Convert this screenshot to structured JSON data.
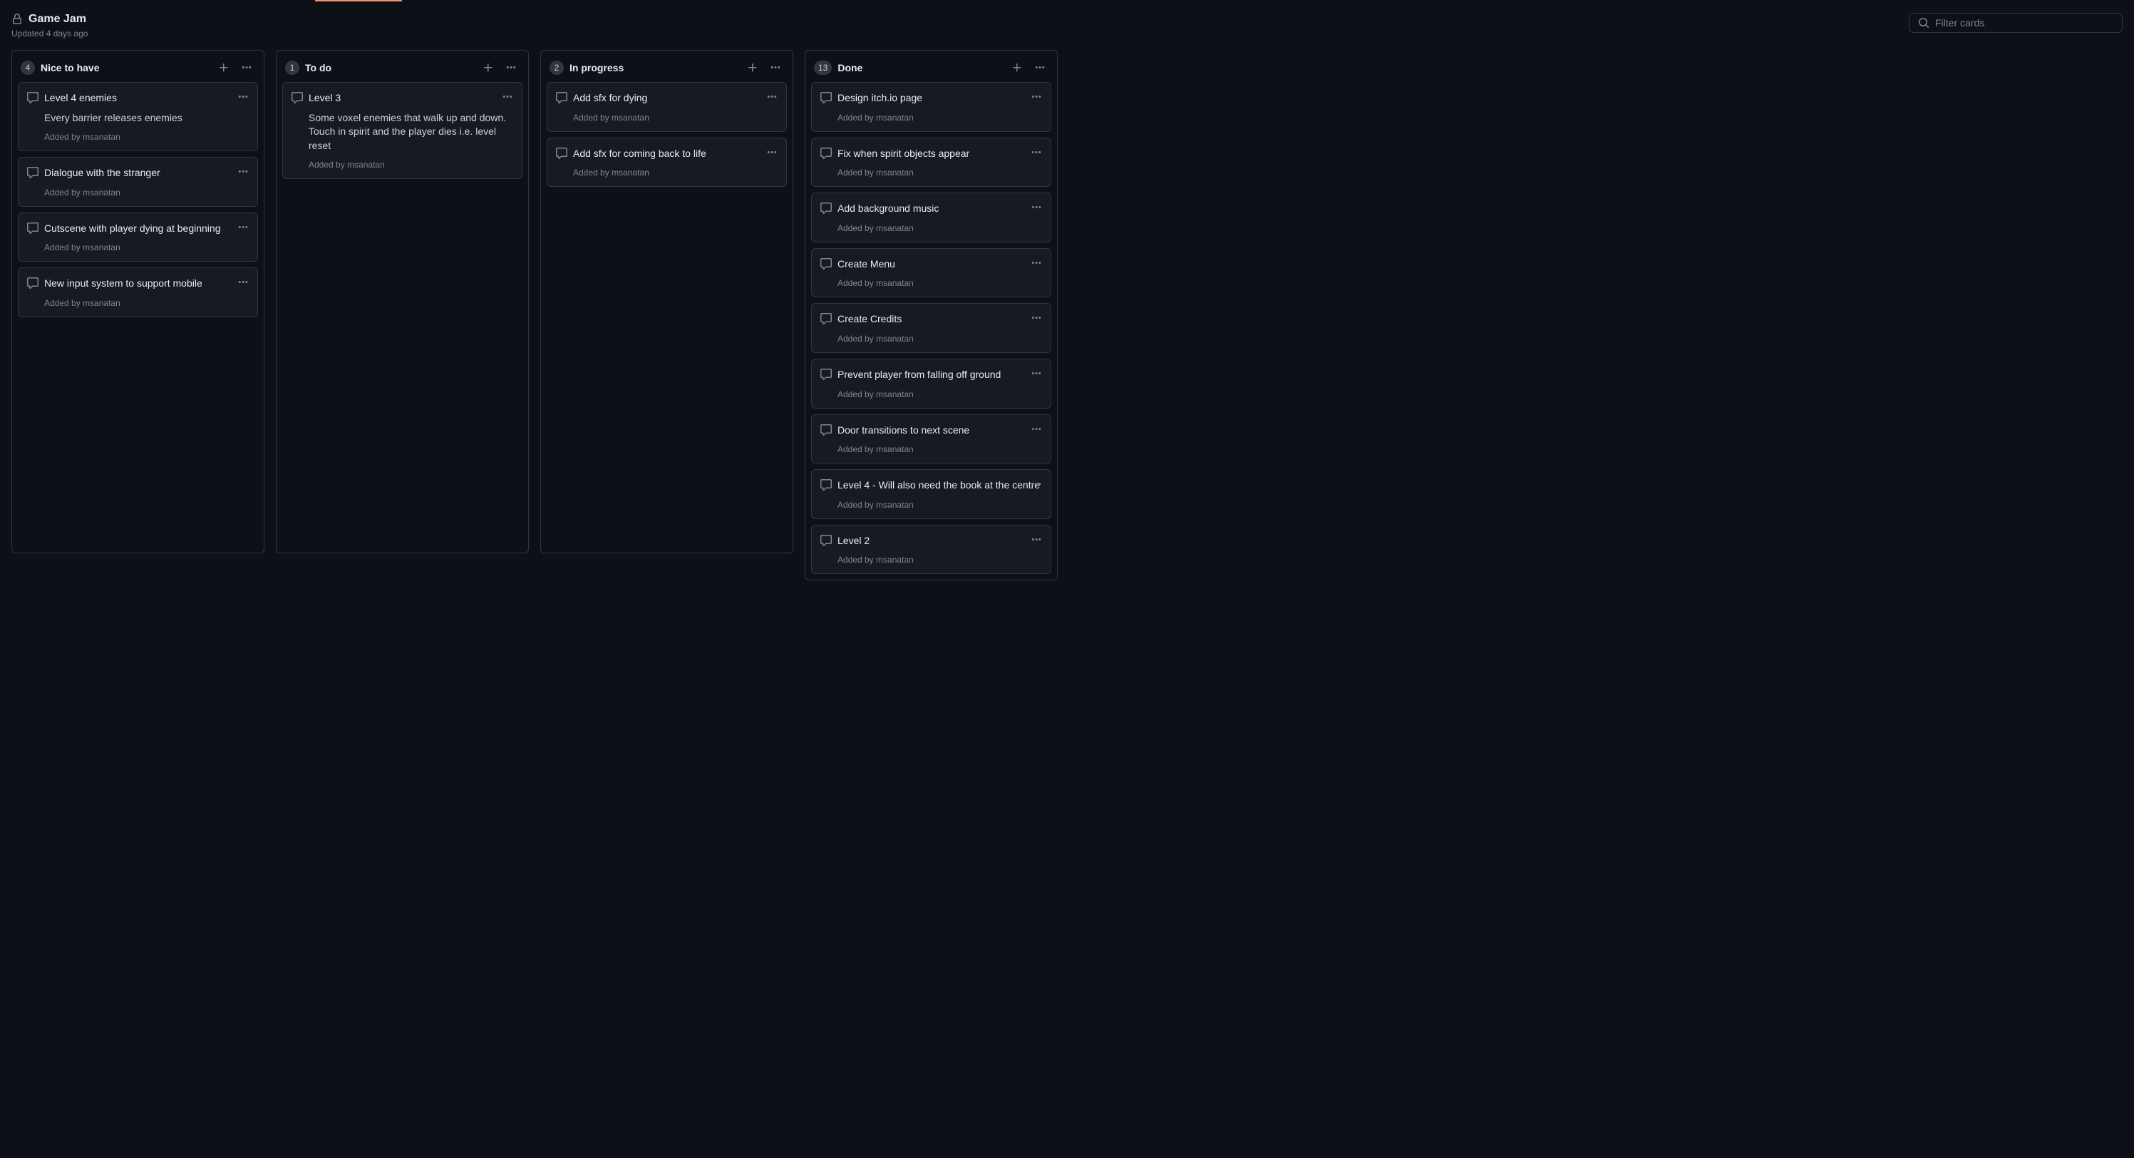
{
  "project": {
    "title": "Game Jam",
    "updated": "Updated 4 days ago"
  },
  "search": {
    "placeholder": "Filter cards"
  },
  "added_by_label": "Added by",
  "columns": [
    {
      "count": "4",
      "title": "Nice to have",
      "cards": [
        {
          "title": "Level 4 enemies",
          "desc": "Every barrier releases enemies",
          "user": "msanatan"
        },
        {
          "title": "Dialogue with the stranger",
          "user": "msanatan"
        },
        {
          "title": "Cutscene with player dying at beginning",
          "user": "msanatan"
        },
        {
          "title": "New input system to support mobile",
          "user": "msanatan"
        }
      ]
    },
    {
      "count": "1",
      "title": "To do",
      "cards": [
        {
          "title": "Level 3",
          "desc": "Some voxel enemies that walk up and down. Touch in spirit and the player dies i.e. level reset",
          "user": "msanatan"
        }
      ]
    },
    {
      "count": "2",
      "title": "In progress",
      "cards": [
        {
          "title": "Add sfx for dying",
          "user": "msanatan"
        },
        {
          "title": "Add sfx for coming back to life",
          "user": "msanatan"
        }
      ]
    },
    {
      "count": "13",
      "title": "Done",
      "cards": [
        {
          "title": "Design itch.io page",
          "user": "msanatan"
        },
        {
          "title": "Fix when spirit objects appear",
          "user": "msanatan"
        },
        {
          "title": "Add background music",
          "user": "msanatan"
        },
        {
          "title": "Create Menu",
          "user": "msanatan"
        },
        {
          "title": "Create Credits",
          "user": "msanatan"
        },
        {
          "title": "Prevent player from falling off ground",
          "user": "msanatan"
        },
        {
          "title": "Door transitions to next scene",
          "user": "msanatan"
        },
        {
          "title": "Level 4 - Will also need the book at the centre",
          "user": "msanatan"
        },
        {
          "title": "Level 2",
          "user": "msanatan"
        }
      ]
    }
  ]
}
